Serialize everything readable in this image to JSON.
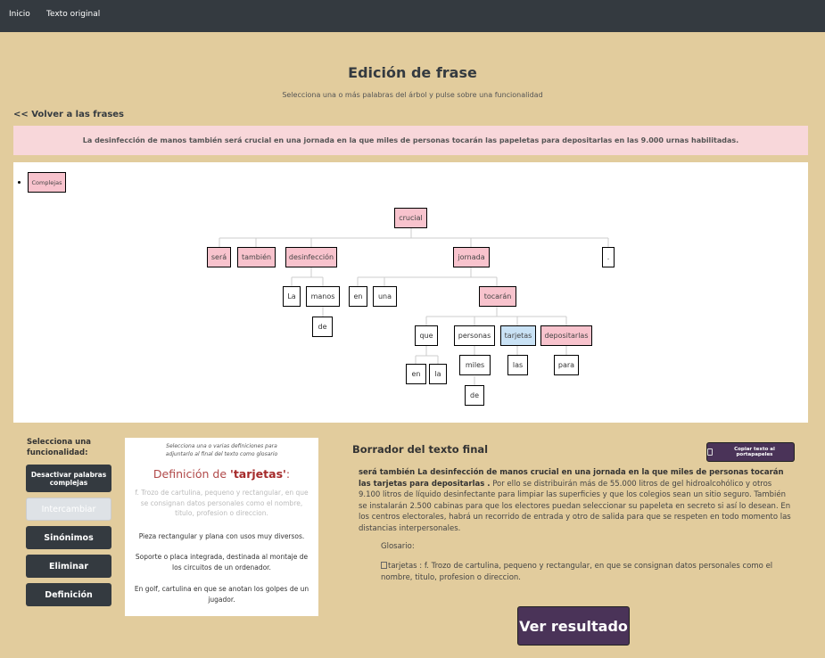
{
  "nav": {
    "inicio": "Inicio",
    "texto_original": "Texto original"
  },
  "page": {
    "title": "Edición de frase",
    "subtitle": "Selecciona una o más palabras del árbol y pulse sobre una funcionalidad",
    "back_link": "<< Volver a las frases"
  },
  "sentence": "La desinfección de manos también será crucial en una jornada en la que miles de personas tocarán las papeletas para depositarlas en las 9.000 urnas habilitadas.",
  "tree": {
    "root_tag": "Complejas",
    "nodes": {
      "crucial": "crucial",
      "sera": "será",
      "tambien": "también",
      "desinfeccion": "desinfección",
      "jornada": "jornada",
      "period": ".",
      "la1": "La",
      "manos": "manos",
      "de1": "de",
      "en1": "en",
      "una": "una",
      "tocaran": "tocarán",
      "que": "que",
      "personas": "personas",
      "tarjetas": "tarjetas",
      "depositarlas": "depositarlas",
      "en2": "en",
      "la2": "la",
      "miles": "miles",
      "de2": "de",
      "las": "las",
      "para": "para"
    }
  },
  "functions": {
    "label": "Selecciona una funcionalidad:",
    "desactivar": "Desactivar palabras complejas",
    "intercambiar": "Intercambiar",
    "sinonimos": "Sinónimos",
    "eliminar": "Eliminar",
    "definicion": "Definición"
  },
  "definitions": {
    "hint": "Selecciona una o varias definiciones para adjuntarlo al final del texto como glosario",
    "title_prefix": "Definición de ",
    "title_word": "'tarjetas'",
    "title_suffix": ":",
    "items": [
      "f. Trozo de cartulina, pequeno y rectangular, en que se consignan datos personales como el nombre, titulo, profesion o direccion.",
      "Pieza rectangular y plana con usos muy diversos.",
      "Soporte o placa integrada, destinada al montaje de los circuitos de un ordenador.",
      "En golf, cartulina en que se anotan los golpes de un jugador."
    ]
  },
  "draft": {
    "title": "Borrador del texto final",
    "copy_button": "Copiar texto al portapapeles",
    "bold_part": "será también La desinfección de manos crucial en una jornada en la que miles de personas tocarán las tarjetas para depositarlas .",
    "rest_part": " Por ello se distribuirán más de 55.000 litros de gel hidroalcohólico y otros 9.100 litros de líquido desinfectante para limpiar las superficies y que los colegios sean un sitio seguro. También se instalarán 2.500 cabinas para que los electores puedan seleccionar su papeleta en secreto si así lo desean. En los centros electorales, habrá un recorrido de entrada y otro de salida para que se respeten en todo momento las distancias interpersonales.",
    "glosario_label": "Glosario:",
    "glosario_entry": "tarjetas : f. Trozo de cartulina, pequeno y rectangular, en que se consignan datos personales como el nombre, titulo, profesion o direccion.",
    "result_button": "Ver resultado"
  }
}
